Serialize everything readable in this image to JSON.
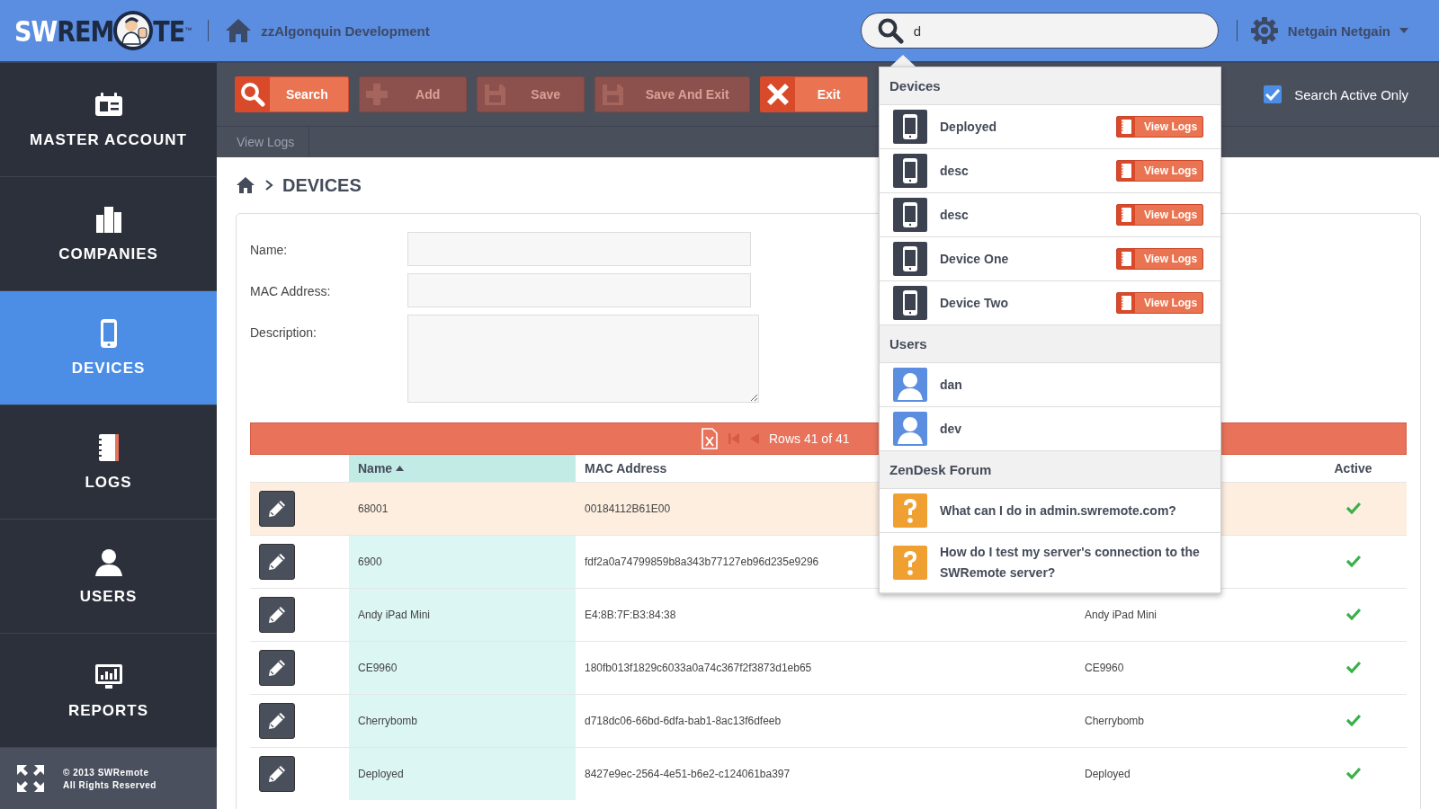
{
  "logo": {
    "parts": [
      {
        "text": "SW",
        "kind": "light"
      },
      {
        "text": "REM",
        "kind": "dark"
      }
    ],
    "after": "TE",
    "mark": "™"
  },
  "header": {
    "site": "zzAlgonquin Development",
    "search": {
      "value": "d"
    },
    "account": "Netgain Netgain"
  },
  "sidebar": {
    "items": [
      {
        "label": "MASTER ACCOUNT",
        "kind": "account",
        "selected": false
      },
      {
        "label": "COMPANIES",
        "kind": "companies",
        "selected": false
      },
      {
        "label": "DEVICES",
        "kind": "devices",
        "selected": true
      },
      {
        "label": "LOGS",
        "kind": "logs",
        "selected": false
      },
      {
        "label": "USERS",
        "kind": "users",
        "selected": false
      },
      {
        "label": "REPORTS",
        "kind": "reports",
        "selected": false
      }
    ],
    "footer": [
      "© 2013 SWRemote",
      "All Rights Reserved"
    ]
  },
  "toolbar": {
    "buttons": [
      {
        "label": "Search",
        "kind": "search",
        "disabled": false
      },
      {
        "label": "Add",
        "kind": "add",
        "disabled": true
      },
      {
        "label": "Save",
        "kind": "save",
        "disabled": true
      },
      {
        "label": "Save And Exit",
        "kind": "save",
        "disabled": true
      },
      {
        "label": "Exit",
        "kind": "exit",
        "disabled": false
      }
    ],
    "tabs": [
      {
        "label": "View Logs",
        "disabled": true
      }
    ],
    "search_active_only": {
      "label": "Search Active Only",
      "checked": true
    }
  },
  "breadcrumb": {
    "title": "DEVICES"
  },
  "form": {
    "fields": [
      {
        "label": "Name:",
        "kind": "input"
      },
      {
        "label": "MAC Address:",
        "kind": "input"
      },
      {
        "label": "Description:",
        "kind": "textarea"
      }
    ]
  },
  "pager": {
    "text": "Rows 41 of 41"
  },
  "table": {
    "columns": [
      {
        "label": "Name",
        "sorted": true
      },
      {
        "label": "MAC Address",
        "sorted": false
      },
      {
        "label": "Active",
        "sorted": false
      }
    ],
    "rows": [
      {
        "name": "68001",
        "mac": "00184112B61E00",
        "active": true,
        "selected": true
      },
      {
        "name": "6900",
        "mac": "fdf2a0a74799859b8a343b77127eb96d235e9296",
        "active": true,
        "selected": false
      },
      {
        "name": "Andy iPad Mini",
        "mac": "E4:8B:7F:B3:84:38",
        "column_3": "Andy iPad Mini",
        "active": true,
        "selected": false
      },
      {
        "name": "CE9960",
        "mac": "180fb013f1829c6033a0a74c367f2f3873d1eb65",
        "column_3": "CE9960",
        "active": true,
        "selected": false
      },
      {
        "name": "Cherrybomb",
        "mac": "d718dc06-66bd-6dfa-bab1-8ac13f6dfeeb",
        "column_3": "Cherrybomb",
        "active": true,
        "selected": false
      },
      {
        "name": "Deployed",
        "mac": "8427e9ec-2564-4e51-b6e2-c124061ba397",
        "column_3": "Deployed",
        "active": true,
        "selected": false
      }
    ]
  },
  "search_results": {
    "sections": [
      {
        "title": "Devices",
        "kind": "device",
        "items": [
          {
            "label": "Deployed",
            "action": "View Logs"
          },
          {
            "label": "desc",
            "action": "View Logs"
          },
          {
            "label": "desc",
            "action": "View Logs"
          },
          {
            "label": "Device One",
            "action": "View Logs"
          },
          {
            "label": "Device Two",
            "action": "View Logs"
          }
        ]
      },
      {
        "title": "Users",
        "kind": "user",
        "items": [
          {
            "label": "dan"
          },
          {
            "label": "dev"
          }
        ]
      },
      {
        "title": "ZenDesk Forum",
        "kind": "article",
        "items": [
          {
            "label": "What can I do in admin.swremote.com?"
          },
          {
            "label": "How do I test my server's connection to the SWRemote server?"
          }
        ]
      }
    ]
  }
}
